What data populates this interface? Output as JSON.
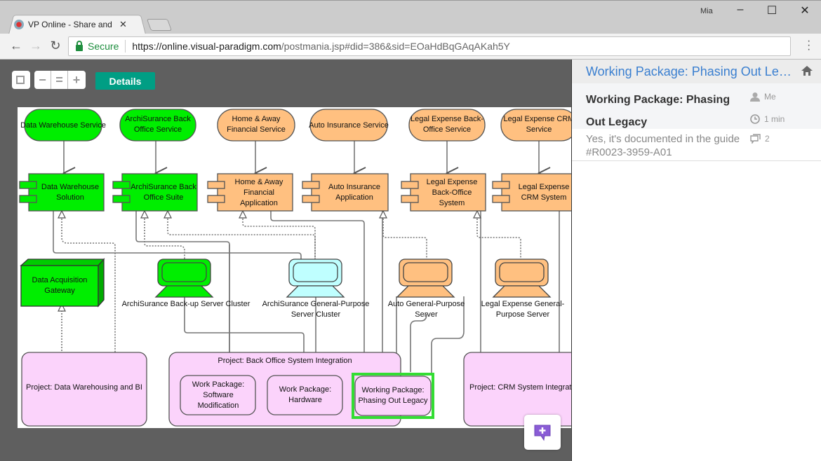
{
  "browser": {
    "tab_title": "VP Online - Share and Dis",
    "profile_name": "Mia",
    "secure_label": "Secure",
    "url_host": "https://online.visual-paradigm.com",
    "url_rest": "/postmania.jsp#did=386&sid=EOaHdBqGAqAKah5Y"
  },
  "toolbar": {
    "details_label": "Details"
  },
  "diagram": {
    "services": [
      {
        "label": "Data Warehouse Service",
        "color": "#00ee00"
      },
      {
        "label": "ArchiSurance Back Office Service",
        "color": "#00ee00"
      },
      {
        "label": "Home & Away Financial Service",
        "color": "#ffc080"
      },
      {
        "label": "Auto Insurance Service",
        "color": "#ffc080"
      },
      {
        "label": "Legal Expense Back-Office Service",
        "color": "#ffc080"
      },
      {
        "label": "Legal Expense CRM Service",
        "color": "#ffc080"
      }
    ],
    "components": [
      {
        "label": "Data Warehouse Solution"
      },
      {
        "label": "ArchiSurance Back Office Suite"
      },
      {
        "label": "Home & Away Financial Application"
      },
      {
        "label": "Auto Insurance Application"
      },
      {
        "label": "Legal Expense Back-Office System"
      },
      {
        "label": "Legal Expense CRM System"
      }
    ],
    "nodes": [
      {
        "label": "Data Acquisition Gateway"
      },
      {
        "label": "ArchiSurance Back-up Server Cluster"
      },
      {
        "label": "ArchiSurance General-Purpose Server Cluster"
      },
      {
        "label": "Auto General-Purpose Server"
      },
      {
        "label": "Legal Expense General-Purpose Server"
      }
    ],
    "projects": [
      {
        "label": "Project: Data Warehousing and BI"
      },
      {
        "label": "Project: Back Office System Integration"
      },
      {
        "label": "Project: CRM System Integration"
      }
    ],
    "work_packages": [
      {
        "label": "Work Package: Software Modification"
      },
      {
        "label": "Work Package: Hardware"
      },
      {
        "label": "Working Package: Phasing Out Legacy",
        "selected": true
      }
    ]
  },
  "panel": {
    "header_title": "Working Package: Phasing Out Legacy",
    "post_title": "Working Package: Phasing Out Legacy",
    "author": "Me",
    "time": "1 min",
    "reply_text": "Yes, it's documented in the guide #R0023-3959-A01",
    "reply_count": "2"
  },
  "colors": {
    "accent_details": "#009e84",
    "panel_link": "#3a7fd0",
    "selection": "#33dd33"
  }
}
